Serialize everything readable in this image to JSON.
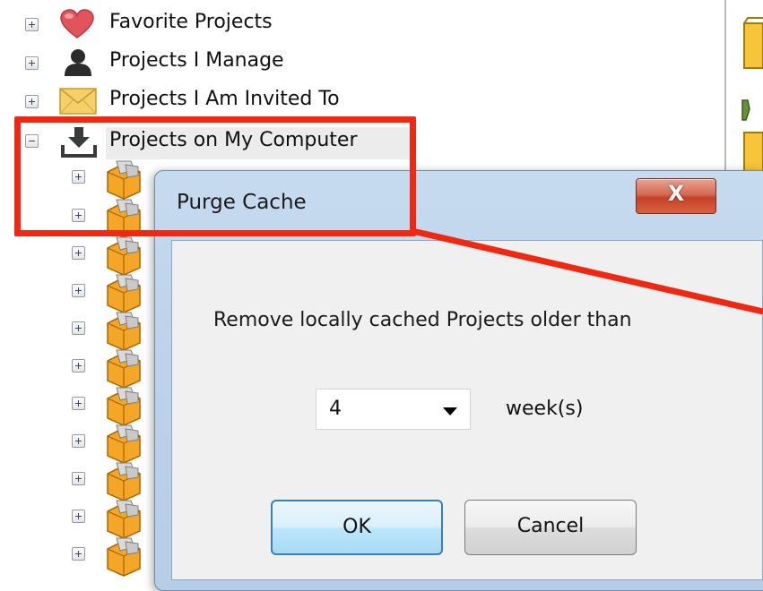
{
  "tree": {
    "items": [
      {
        "label": "Favorite Projects",
        "icon": "heart-icon"
      },
      {
        "label": "Projects I Manage",
        "icon": "person-icon"
      },
      {
        "label": "Projects I Am Invited To",
        "icon": "envelope-icon"
      },
      {
        "label": "Projects on My Computer",
        "icon": "download-icon"
      }
    ]
  },
  "dialog": {
    "title": "Purge Cache",
    "close_label": "X",
    "message": "Remove locally cached Projects older than",
    "period_value": "4",
    "period_unit": "week(s)",
    "ok_label": "OK",
    "cancel_label": "Cancel"
  },
  "colors": {
    "annotation": "#f02811",
    "dialog_frame": "#bcd3ea",
    "ok_border": "#3c7fb1",
    "close_button": "#c44128"
  }
}
